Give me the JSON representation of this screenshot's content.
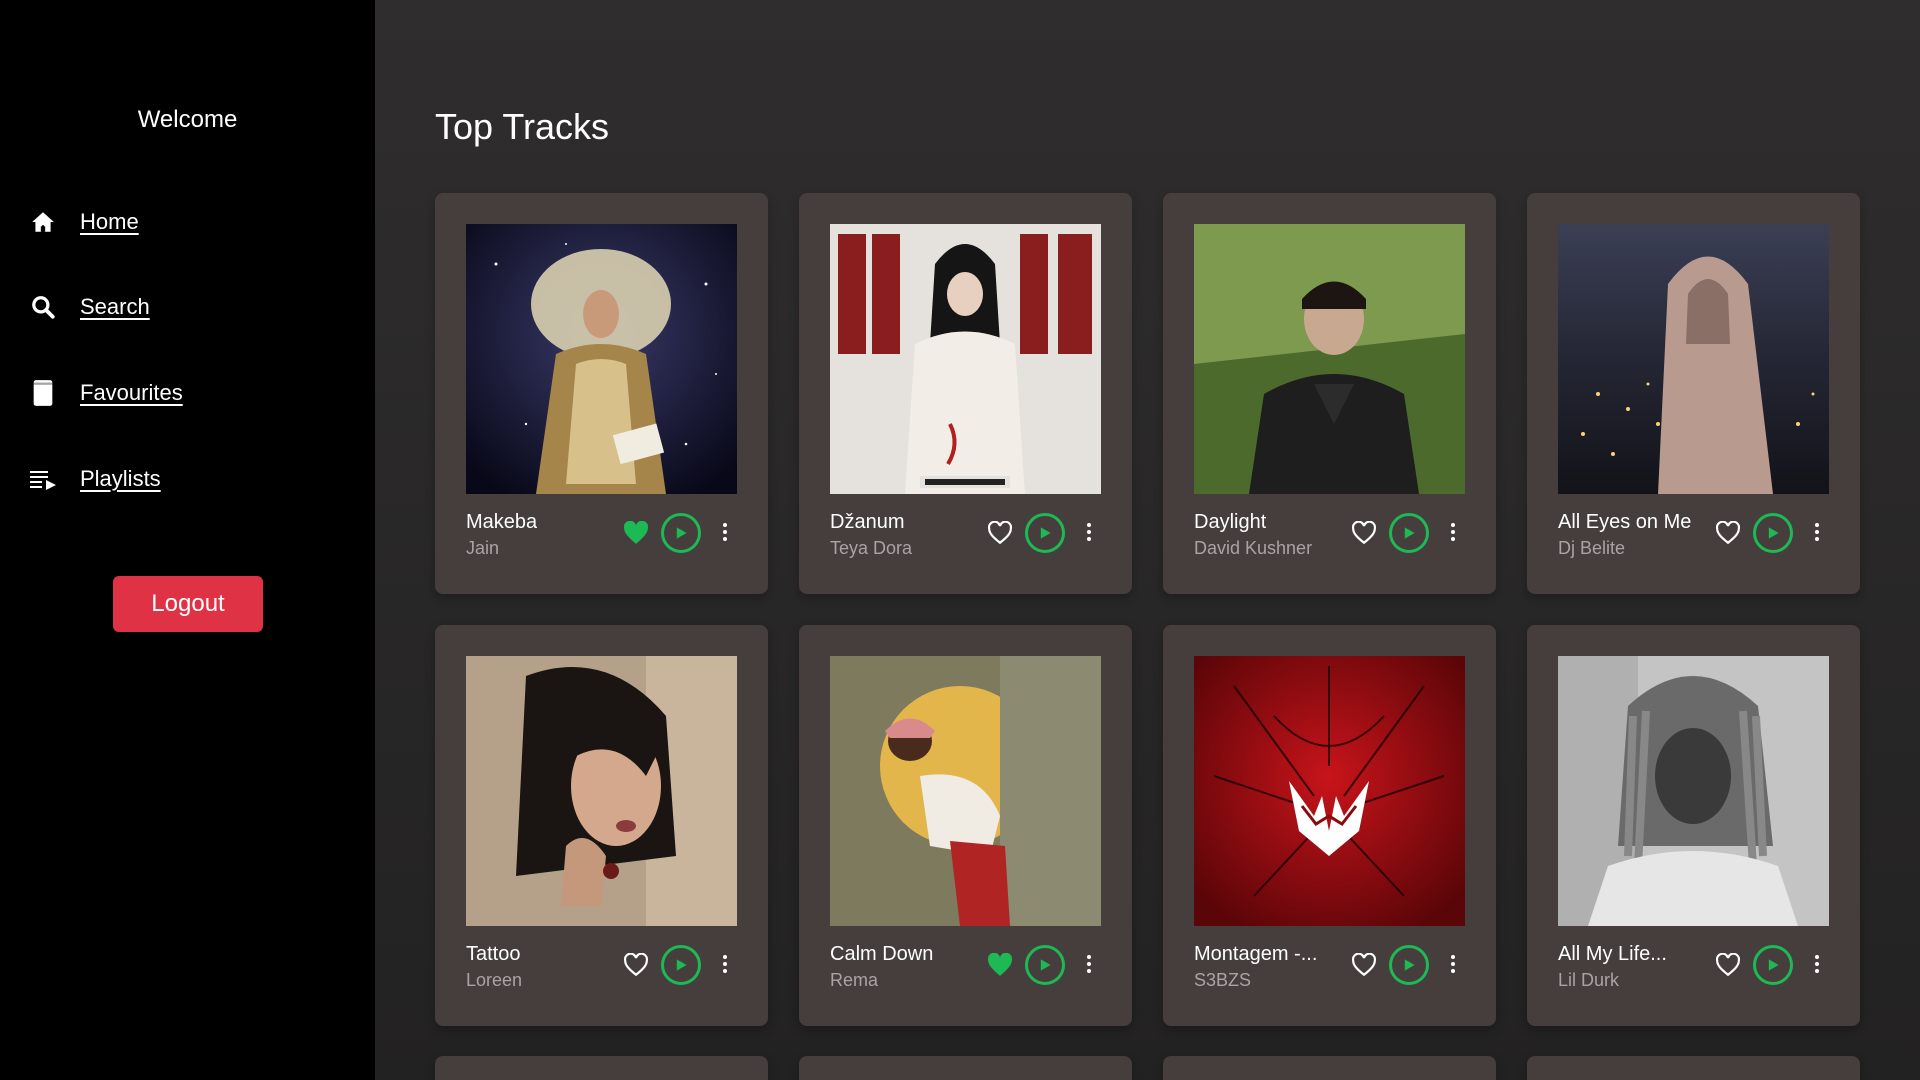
{
  "sidebar": {
    "welcome": "Welcome",
    "nav": [
      {
        "label": "Home",
        "icon": "home-icon"
      },
      {
        "label": "Search",
        "icon": "search-icon"
      },
      {
        "label": "Favourites",
        "icon": "book-icon"
      },
      {
        "label": "Playlists",
        "icon": "playlist-icon"
      }
    ],
    "logout_label": "Logout"
  },
  "main": {
    "title": "Top Tracks",
    "tracks": [
      {
        "title": "Makeba",
        "artist": "Jain",
        "liked": true
      },
      {
        "title": "Džanum",
        "artist": "Teya Dora",
        "liked": false
      },
      {
        "title": "Daylight",
        "artist": "David Kushner",
        "liked": false
      },
      {
        "title": "All Eyes on Me",
        "artist": "Dj Belite",
        "liked": false
      },
      {
        "title": "Tattoo",
        "artist": "Loreen",
        "liked": false
      },
      {
        "title": "Calm Down",
        "artist": "Rema",
        "liked": true
      },
      {
        "title": "Montagem -...",
        "artist": "S3BZS",
        "liked": false
      },
      {
        "title": "All My Life...",
        "artist": "Lil Durk",
        "liked": false
      }
    ]
  },
  "colors": {
    "sidebar_bg": "#000000",
    "main_bg": "#2a2828",
    "card_bg": "#463d3d",
    "accent_green": "#1db954",
    "logout_red": "#e03245",
    "artist_gray": "#a9a4a4"
  }
}
